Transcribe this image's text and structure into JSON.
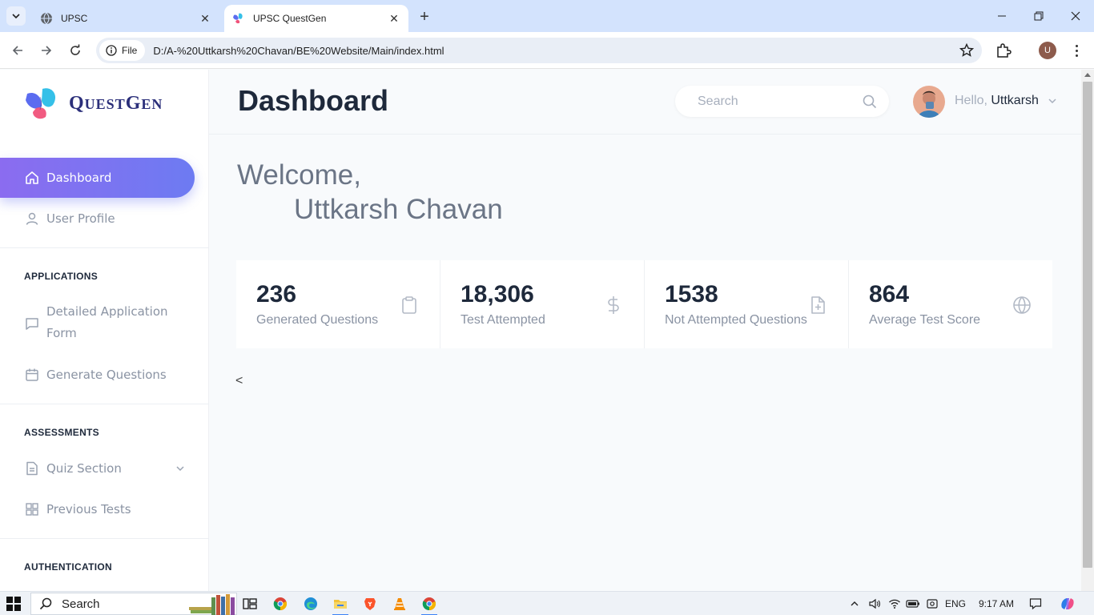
{
  "browser": {
    "tabs": [
      {
        "title": "UPSC",
        "active": false
      },
      {
        "title": "UPSC QuestGen",
        "active": true
      }
    ],
    "new_tab_symbol": "+",
    "omnibox": {
      "chip_label": "File",
      "url": "D:/A-%20Uttkarsh%20Chavan/BE%20Website/Main/index.html"
    },
    "profile_initial": "U"
  },
  "sidebar": {
    "logo_text": "QuestGen",
    "logo_caps": {
      "q": "Q",
      "uest": "UEST",
      "g": "G",
      "en": "EN"
    },
    "items": [
      {
        "label": "Dashboard",
        "icon": "home-icon",
        "active": true
      },
      {
        "label": "User Profile",
        "icon": "user-icon",
        "active": false
      }
    ],
    "sections": [
      {
        "title": "APPLICATIONS",
        "items": [
          {
            "label": "Detailed Application Form",
            "icon": "message-square-icon"
          },
          {
            "label": "Generate Questions",
            "icon": "calendar-icon"
          }
        ]
      },
      {
        "title": "ASSESSMENTS",
        "items": [
          {
            "label": "Quiz Section",
            "icon": "file-text-icon",
            "has_submenu": true
          },
          {
            "label": "Previous Tests",
            "icon": "grid-icon"
          }
        ]
      },
      {
        "title": "AUTHENTICATION",
        "items": []
      }
    ]
  },
  "header": {
    "title": "Dashboard",
    "search_placeholder": "Search",
    "greeting": "Hello,",
    "user_name": "Uttkarsh"
  },
  "welcome": {
    "line1": "Welcome,",
    "line2": "Uttkarsh Chavan"
  },
  "stats": [
    {
      "value": "236",
      "label": "Generated Questions",
      "icon": "clipboard-icon"
    },
    {
      "value": "18,306",
      "label": "Test Attempted",
      "icon": "dollar-icon"
    },
    {
      "value": "1538",
      "label": "Not Attempted Questions",
      "icon": "file-plus-icon"
    },
    {
      "value": "864",
      "label": "Average Test Score",
      "icon": "globe-icon"
    }
  ],
  "carousel_prev": "<",
  "taskbar": {
    "search_label": "Search",
    "language": "ENG",
    "time": "9:17 AM"
  },
  "colors": {
    "accent_start": "#8b6cf0",
    "accent_end": "#6d7bf2",
    "heading": "#1e293b",
    "muted": "#8a93a3",
    "brand": "#2b2f7a"
  }
}
